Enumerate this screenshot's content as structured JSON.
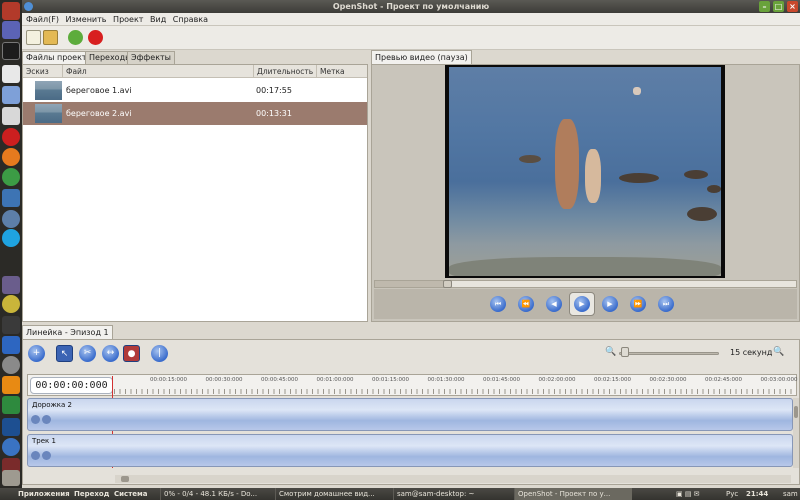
{
  "window": {
    "title": "OpenShot - Проект по умолчанию"
  },
  "menu": [
    "Файл(F)",
    "Изменить",
    "Проект",
    "Вид",
    "Справка"
  ],
  "left_tabs": [
    "Файлы проекта",
    "Переходы",
    "Эффекты"
  ],
  "files": {
    "columns": [
      "Эскиз",
      "Файл",
      "Длительность",
      "Метка"
    ],
    "rows": [
      {
        "name": "береговое 1.avi",
        "duration": "00:17:55"
      },
      {
        "name": "береговое 2.avi",
        "duration": "00:13:31"
      }
    ]
  },
  "preview": {
    "tab": "Превью видео (пауза)",
    "position": 0.17
  },
  "timeline": {
    "tab": "Линейка - Эпизод 1",
    "zoom_label": "15 секунд",
    "timecode": "00:00:00:000",
    "ruler_labels": [
      "00:00:15:000",
      "00:00:30:000",
      "00:00:45:000",
      "00:01:00:000",
      "00:01:15:000",
      "00:01:30:000",
      "00:01:45:000",
      "00:02:00:000",
      "00:02:15:000",
      "00:02:30:000",
      "00:02:45:000",
      "00:03:00:000"
    ],
    "tracks": [
      "Дорожка 2",
      "Трек 1"
    ]
  },
  "panel": {
    "menus": [
      "Приложения",
      "Переход",
      "Система"
    ],
    "tasks": [
      "0% - 0/4 - 48.1 КБ/s - Do...",
      "Смотрим домашнее вид...",
      "sam@sam-desktop: ~",
      "OpenShot - Проект по у..."
    ],
    "keyboard": "Рус",
    "clock": "21:44",
    "user": "sam"
  },
  "icons": {
    "dock": [
      "power-icon",
      "cursor-icon",
      "terminal-icon",
      "gmail-icon",
      "rss-icon",
      "media-icon",
      "opera-icon",
      "firefox-icon",
      "chrome-icon",
      "python-icon",
      "gimp-icon",
      "skype-icon",
      "pidgin-icon",
      "picasa-icon",
      "openshot-icon",
      "clapper-icon",
      "settings-icon",
      "vlc-icon",
      "sun-icon",
      "spreadsheet-icon",
      "puzzle-icon",
      "virtualbox-icon",
      "help-icon",
      "cinelerra-icon",
      "trash-icon"
    ],
    "accent": "#9b7b6e"
  }
}
